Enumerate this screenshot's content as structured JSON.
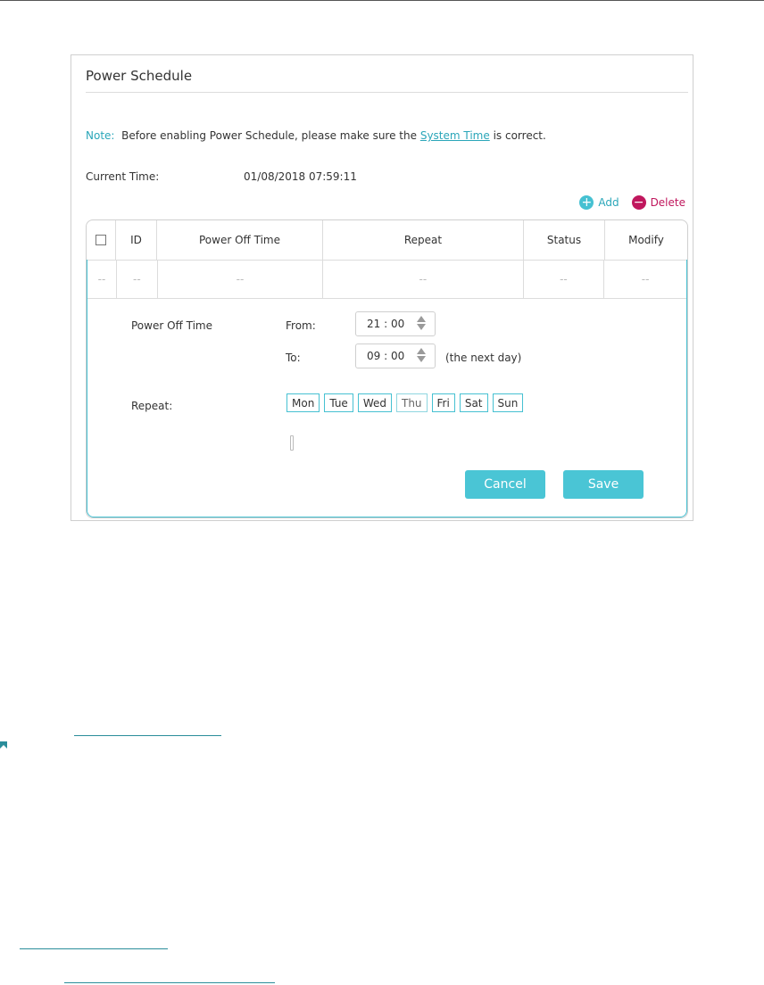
{
  "panel": {
    "title": "Power Schedule",
    "note": {
      "label": "Note:",
      "text_before": "Before enabling Power Schedule, please make sure the",
      "link": "System Time",
      "text_after": "is correct."
    },
    "current_time": {
      "label": "Current Time:",
      "value": "01/08/2018 07:59:11"
    },
    "actions": {
      "add": "Add",
      "delete": "Delete"
    },
    "table": {
      "columns": [
        "ID",
        "Power Off Time",
        "Repeat",
        "Status",
        "Modify"
      ],
      "row": [
        "--",
        "--",
        "--",
        "--",
        "--",
        "--"
      ]
    },
    "form": {
      "power_off_label": "Power Off Time",
      "from_label": "From:",
      "from_value": "21 : 00",
      "to_label": "To:",
      "to_value": "09 : 00",
      "next_day": "(the next day)",
      "repeat_label": "Repeat:",
      "days": [
        "Mon",
        "Tue",
        "Wed",
        "Thu",
        "Fri",
        "Sat",
        "Sun"
      ],
      "days_selected": [
        "Mon",
        "Tue",
        "Wed",
        "Fri",
        "Sat",
        "Sun"
      ],
      "cancel": "Cancel",
      "save": "Save"
    }
  },
  "colors": {
    "accent": "#46c1d2",
    "link": "#2aa6b9",
    "delete": "#c0175d"
  }
}
